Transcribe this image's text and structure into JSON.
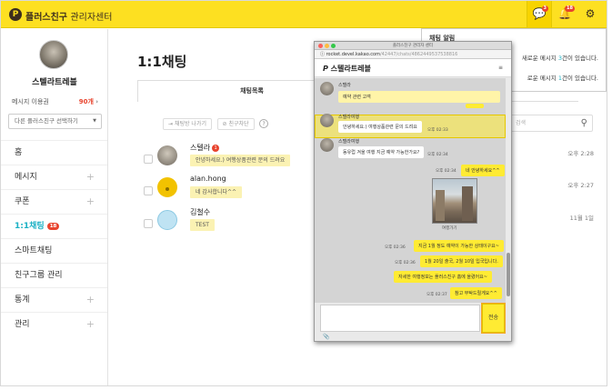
{
  "header": {
    "logo_glyph": "P",
    "brand_name": "플러스친구",
    "brand_sub": "관리자센터",
    "chat_badge": "3",
    "bell_badge": "18"
  },
  "sidebar": {
    "profile_name": "스텔라트레블",
    "msg_quota_label": "메시지 이용권",
    "msg_quota_count": "90개",
    "friend_select": "다른 플러스친구 선택하기",
    "items": [
      {
        "label": "홈",
        "plus": ""
      },
      {
        "label": "메시지",
        "plus": "+"
      },
      {
        "label": "쿠폰",
        "plus": "+"
      },
      {
        "label": "1:1채팅",
        "plus": "",
        "badge": "18"
      },
      {
        "label": "스마트채팅",
        "plus": ""
      },
      {
        "label": "친구그룹 관리",
        "plus": ""
      },
      {
        "label": "통계",
        "plus": "+"
      },
      {
        "label": "관리",
        "plus": "+"
      }
    ]
  },
  "main": {
    "title": "1:1채팅",
    "tab_chat_list": "채팅목록",
    "btn_leave": "채팅방 나가기",
    "btn_block": "친구차단",
    "help": "?",
    "search_placeholder": "검색",
    "chats": [
      {
        "name": "스텔라",
        "unread": "1",
        "message": "안녕하세요.) 여행상품관련 문의 드려요",
        "time": "오후 2:28"
      },
      {
        "name": "alan.hong",
        "message": "네 감사합니다^^",
        "time": "오후 2:27"
      },
      {
        "name": "김철수",
        "message": "TEST",
        "time": "11월 1일"
      }
    ]
  },
  "notification": {
    "title": "채팅 알림",
    "line1_pre": "새로운 메시지 ",
    "line1_count": "3",
    "line1_post": "건이 있습니다.",
    "line2_pre": "로운 메시지 ",
    "line2_count": "1",
    "line2_post": "건이 있습니다."
  },
  "chat_window": {
    "window_title": "플러스친구 관리자 센터",
    "url_host": "rocket.devel.kakao.com",
    "url_path": "/42447/chats/4862449537538816",
    "header_name": "스텔라트레블",
    "menu_icon": "≡",
    "msg_top_name": "스텔라",
    "msg_top_text": "예약 관련 고객",
    "msgs": [
      {
        "sender": "스텔라여행",
        "text": "안녕하세요.) 여행상품관련 문의 드려요",
        "time": "오후 02:33"
      },
      {
        "sender": "스텔라여행",
        "text": "동유럽 겨울 여행 지금 예약 가능한가요?",
        "time": "오후 02:34"
      }
    ],
    "my_msgs": [
      {
        "text": "네 안녕하세요^^",
        "time": "오후 02:34"
      },
      {
        "text": "지금 1월 정도 예약이 가능한 상태이구요~",
        "time": "오후 02:36"
      },
      {
        "text": "1월 20일 출국, 2월 10일 입국입니다.",
        "time": "오후 02:36"
      },
      {
        "text": "자세한 여행정보는 플러스친구 홈에 올렸어요~",
        "time": ""
      },
      {
        "text": "참고 부탁드릴게요^^",
        "time": "오후 02:37"
      }
    ],
    "photo_caption": "여행가기",
    "send_label": "전송"
  }
}
